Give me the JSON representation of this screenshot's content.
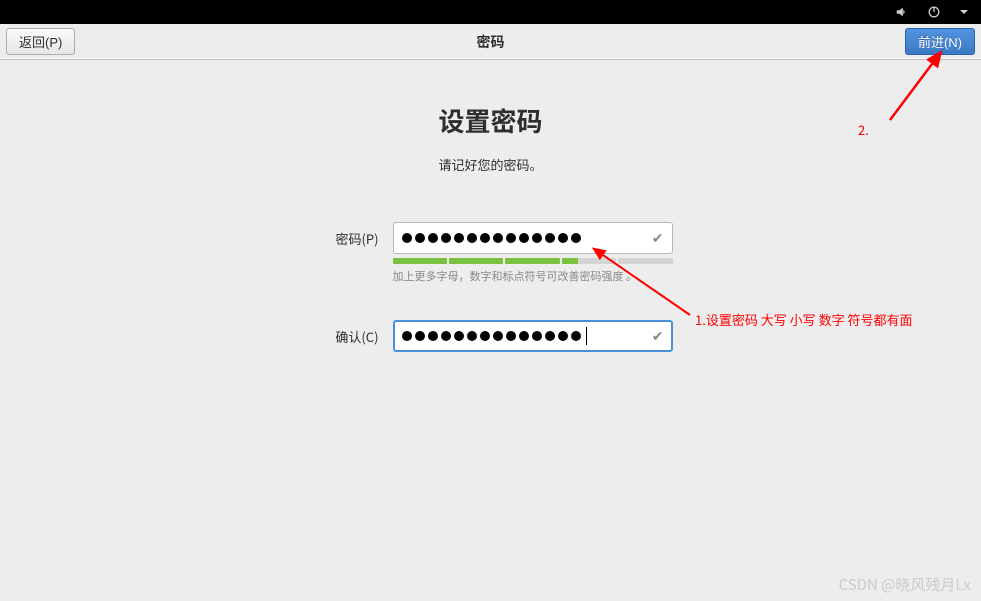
{
  "toolbar": {
    "back_label": "返回(P)",
    "title": "密码",
    "forward_label": "前进(N)"
  },
  "content": {
    "heading": "设置密码",
    "subheading": "请记好您的密码。",
    "password_label": "密码(P)",
    "confirm_label": "确认(C)",
    "password_value": "●●●●●●●●●●●●●●",
    "confirm_value": "●●●●●●●●●●●●●●",
    "strength_hint": "加上更多字母，数字和标点符号可改善密码强度 。"
  },
  "strength": {
    "segments": [
      "filled",
      "filled",
      "filled",
      "partial",
      "empty"
    ]
  },
  "annotations": {
    "note1": "1.设置密码 大写 小写 数字 符号都有面",
    "note2": "2."
  },
  "watermark": "CSDN @晓风残月Lx",
  "icons": {
    "speaker": "speaker",
    "power": "power",
    "dropdown": "triangle"
  }
}
